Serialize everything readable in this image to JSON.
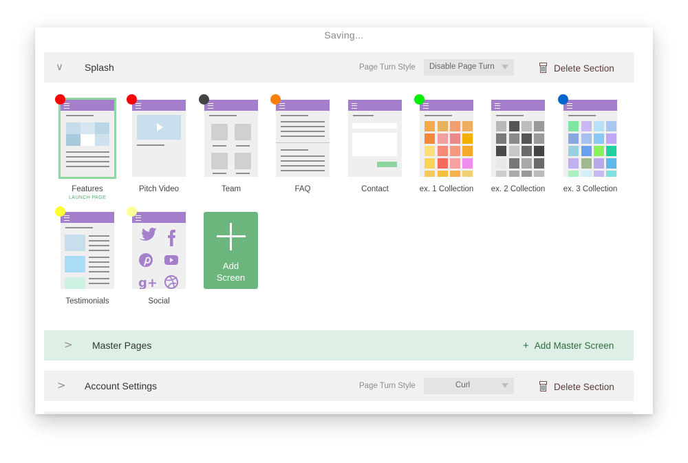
{
  "status": {
    "saving": "Saving..."
  },
  "sections": {
    "splash": {
      "title": "Splash",
      "page_turn_label": "Page Turn Style",
      "page_turn_value": "Disable Page Turn",
      "delete_label": "Delete Section"
    },
    "master": {
      "title": "Master Pages",
      "add_label": "Add Master Screen"
    },
    "account": {
      "title": "Account Settings",
      "page_turn_label": "Page Turn Style",
      "page_turn_value": "Curl",
      "delete_label": "Delete Section"
    }
  },
  "screens": [
    {
      "label": "Features",
      "sublabel": "LAUNCH PAGE",
      "dot_color": "#ff0000",
      "selected": true
    },
    {
      "label": "Pitch Video",
      "dot_color": "#ff0000"
    },
    {
      "label": "Team",
      "dot_color": "#444444"
    },
    {
      "label": "FAQ",
      "dot_color": "#ff7f00"
    },
    {
      "label": "Contact",
      "dot_color": null
    },
    {
      "label": "ex. 1 Collection",
      "dot_color": "#00ee00"
    },
    {
      "label": "ex. 2 Collection",
      "dot_color": null
    },
    {
      "label": "ex. 3 Collection",
      "dot_color": "#0066cc"
    },
    {
      "label": "Testimonials",
      "dot_color": "#ffff33"
    },
    {
      "label": "Social",
      "dot_color": "#ffff99"
    }
  ],
  "add_screen": {
    "line1": "Add",
    "line2": "Screen"
  },
  "icons": {
    "expand_open": "chevron-down-icon",
    "expand_closed": "chevron-right-icon",
    "delete": "trash-icon",
    "add": "plus-icon",
    "menu": "hamburger-icon"
  },
  "colors": {
    "header_bar": "#a57fcb",
    "add_screen_bg": "#6cb57d",
    "master_bg": "#def0e6",
    "section_bg": "#f1f1f1",
    "selected_outline": "#8ed8a0"
  }
}
